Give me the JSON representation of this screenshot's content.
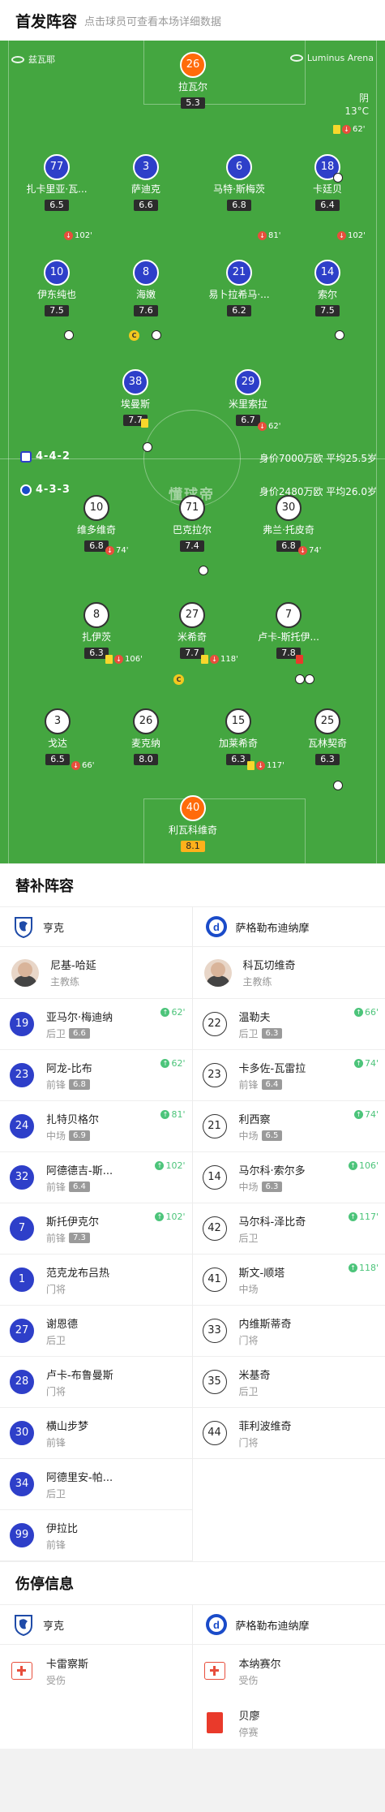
{
  "header": {
    "title": "首发阵容",
    "subtitle": "点击球员可查看本场详细数据"
  },
  "pitch": {
    "referee": "兹瓦耶",
    "stadium": "Luminus Arena",
    "weather": "阴",
    "temperature": "13°C",
    "watermark": "懂球帝",
    "home": {
      "formation": "4-4-2",
      "value": "身价7000万欧 平均25.5岁"
    },
    "away": {
      "formation": "4-3-3",
      "value": "身价2480万欧 平均26.0岁"
    },
    "players": [
      {
        "num": "26",
        "name": "拉瓦尔",
        "rating": "5.3",
        "side": "gk"
      },
      {
        "num": "77",
        "name": "扎卡里亚·瓦...",
        "rating": "6.5",
        "side": "home"
      },
      {
        "num": "3",
        "name": "萨迪克",
        "rating": "6.6",
        "side": "home"
      },
      {
        "num": "6",
        "name": "马特·斯梅茨",
        "rating": "6.8",
        "side": "home"
      },
      {
        "num": "18",
        "name": "卡廷贝",
        "rating": "6.4",
        "side": "home"
      },
      {
        "num": "10",
        "name": "伊东纯也",
        "rating": "7.5",
        "side": "home"
      },
      {
        "num": "8",
        "name": "海嫩",
        "rating": "7.6",
        "side": "home"
      },
      {
        "num": "21",
        "name": "易卜拉希马·...",
        "rating": "6.2",
        "side": "home"
      },
      {
        "num": "14",
        "name": "索尔",
        "rating": "7.5",
        "side": "home"
      },
      {
        "num": "38",
        "name": "埃曼斯",
        "rating": "7.7",
        "side": "home"
      },
      {
        "num": "29",
        "name": "米里索拉",
        "rating": "6.7",
        "side": "home"
      },
      {
        "num": "10",
        "name": "维多维奇",
        "rating": "6.8",
        "side": "away"
      },
      {
        "num": "71",
        "name": "巴克拉尔",
        "rating": "7.4",
        "side": "away"
      },
      {
        "num": "30",
        "name": "弗兰·托皮奇",
        "rating": "6.8",
        "side": "away"
      },
      {
        "num": "8",
        "name": "扎伊茨",
        "rating": "6.3",
        "side": "away"
      },
      {
        "num": "27",
        "name": "米希奇",
        "rating": "7.7",
        "side": "away"
      },
      {
        "num": "7",
        "name": "卢卡-斯托伊...",
        "rating": "7.8",
        "side": "away"
      },
      {
        "num": "3",
        "name": "戈达",
        "rating": "6.5",
        "side": "away"
      },
      {
        "num": "26",
        "name": "麦克纳",
        "rating": "8.0",
        "side": "away"
      },
      {
        "num": "15",
        "name": "加莱希奇",
        "rating": "6.3",
        "side": "away"
      },
      {
        "num": "25",
        "name": "瓦林契奇",
        "rating": "6.3",
        "side": "away"
      },
      {
        "num": "40",
        "name": "利瓦科维奇",
        "rating": "8.1",
        "side": "gk"
      }
    ],
    "events": {
      "e18": "62'",
      "e10h": "102'",
      "e21": "81'",
      "e14": "102'",
      "e29": "62'",
      "e10a": "74'",
      "e30": "74'",
      "e8": "106'",
      "e27": "118'",
      "e3": "66'",
      "e15": "117'"
    }
  },
  "subs": {
    "title": "替补阵容",
    "home": {
      "team": "亨克",
      "coach": {
        "name": "尼基-哈延",
        "role": "主教练"
      },
      "players": [
        {
          "num": "19",
          "name": "亚马尔·梅迪纳",
          "pos": "后卫",
          "rating": "6.6",
          "event": "62'"
        },
        {
          "num": "23",
          "name": "阿龙-比布",
          "pos": "前锋",
          "rating": "6.8",
          "event": "62'"
        },
        {
          "num": "24",
          "name": "扎特贝格尔",
          "pos": "中场",
          "rating": "6.9",
          "event": "81'"
        },
        {
          "num": "32",
          "name": "阿德德吉-斯...",
          "pos": "前锋",
          "rating": "6.4",
          "event": "102'"
        },
        {
          "num": "7",
          "name": "斯托伊克尔",
          "pos": "前锋",
          "rating": "7.3",
          "event": "102'"
        },
        {
          "num": "1",
          "name": "范克龙布吕热",
          "pos": "门将",
          "rating": "",
          "event": ""
        },
        {
          "num": "27",
          "name": "谢恩德",
          "pos": "后卫",
          "rating": "",
          "event": ""
        },
        {
          "num": "28",
          "name": "卢卡-布鲁曼斯",
          "pos": "门将",
          "rating": "",
          "event": ""
        },
        {
          "num": "30",
          "name": "横山步梦",
          "pos": "前锋",
          "rating": "",
          "event": ""
        },
        {
          "num": "34",
          "name": "阿德里安-帕...",
          "pos": "后卫",
          "rating": "",
          "event": ""
        },
        {
          "num": "99",
          "name": "伊拉比",
          "pos": "前锋",
          "rating": "",
          "event": ""
        }
      ]
    },
    "away": {
      "team": "萨格勒布迪纳摩",
      "coach": {
        "name": "科瓦切维奇",
        "role": "主教练"
      },
      "players": [
        {
          "num": "22",
          "name": "温勒夫",
          "pos": "后卫",
          "rating": "6.3",
          "event": "66'"
        },
        {
          "num": "23",
          "name": "卡多佐-瓦雷拉",
          "pos": "前锋",
          "rating": "6.4",
          "event": "74'"
        },
        {
          "num": "21",
          "name": "利西察",
          "pos": "中场",
          "rating": "6.5",
          "event": "74'"
        },
        {
          "num": "14",
          "name": "马尔科·索尔多",
          "pos": "中场",
          "rating": "6.3",
          "event": "106'"
        },
        {
          "num": "42",
          "name": "马尔科-泽比奇",
          "pos": "后卫",
          "rating": "",
          "event": "117'"
        },
        {
          "num": "41",
          "name": "斯文-顺塔",
          "pos": "中场",
          "rating": "",
          "event": "118'"
        },
        {
          "num": "33",
          "name": "内维斯蒂奇",
          "pos": "门将",
          "rating": "",
          "event": ""
        },
        {
          "num": "35",
          "name": "米基奇",
          "pos": "后卫",
          "rating": "",
          "event": ""
        },
        {
          "num": "44",
          "name": "菲利波维奇",
          "pos": "门将",
          "rating": "",
          "event": ""
        }
      ]
    }
  },
  "injuries": {
    "title": "伤停信息",
    "home": {
      "team": "亨克",
      "items": [
        {
          "name": "卡雷察斯",
          "status": "受伤",
          "icon": "medical-kit-icon"
        }
      ]
    },
    "away": {
      "team": "萨格勒布迪纳摩",
      "items": [
        {
          "name": "本纳赛尔",
          "status": "受伤",
          "icon": "medical-kit-icon"
        },
        {
          "name": "贝廖",
          "status": "停赛",
          "icon": "red-card-icon"
        }
      ]
    }
  },
  "colors": {
    "pitch": "#44a640",
    "home": "#2e3fc9",
    "keeper": "#ff6b0a",
    "sub_in": "#4cc47a",
    "sub_out": "#e84e3c"
  }
}
